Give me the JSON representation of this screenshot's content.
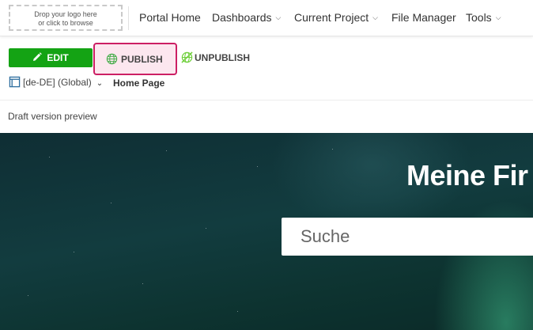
{
  "logo_drop": {
    "line1": "Drop your logo here",
    "line2": "or click to browse"
  },
  "nav": {
    "portal_home": "Portal Home",
    "dashboards": "Dashboards",
    "current_project": "Current Project",
    "file_manager": "File Manager",
    "tools": "Tools"
  },
  "toolbar": {
    "edit_label": "EDIT",
    "publish_label": "PUBLISH",
    "unpublish_label": "UNPUBLISH"
  },
  "locale": {
    "value": "[de-DE] (Global)"
  },
  "page": {
    "name": "Home Page"
  },
  "preview": {
    "label": "Draft version preview"
  },
  "hero": {
    "title": "Meine Fir",
    "search_placeholder": "Suche"
  },
  "colors": {
    "edit_green": "#14a314",
    "publish_highlight_border": "#cc1f64",
    "publish_highlight_bg": "#fce7ef",
    "unpublish_icon_green": "#6fcf3b",
    "hero_dark_teal": "#123c3f"
  }
}
